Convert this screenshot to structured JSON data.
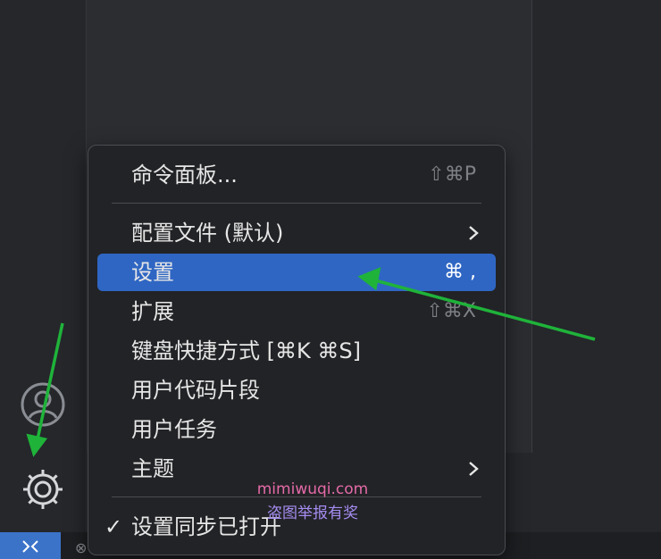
{
  "menu": {
    "items": [
      {
        "label": "命令面板...",
        "shortcut": "⇧⌘P"
      },
      {
        "label": "配置文件 (默认)",
        "submenu": true
      },
      {
        "label": "设置",
        "shortcut": "⌘ ,",
        "highlighted": true
      },
      {
        "label": "扩展",
        "shortcut": "⇧⌘X"
      },
      {
        "label": "键盘快捷方式 [⌘K ⌘S]"
      },
      {
        "label": "用户代码片段"
      },
      {
        "label": "用户任务"
      },
      {
        "label": "主题",
        "submenu": true
      },
      {
        "label": "设置同步已打开",
        "checked": true
      }
    ]
  },
  "activity_bar": {
    "icons": [
      "account-icon",
      "gear-icon"
    ]
  },
  "status_bar": {
    "remote_icon": "remote-icon"
  },
  "watermark": {
    "line1": "mimiwuqi.com",
    "line2": "盗图举报有奖"
  },
  "colors": {
    "highlight": "#2f66c3",
    "annotation_arrow": "#1fb33a",
    "menu_bg": "#222326"
  }
}
